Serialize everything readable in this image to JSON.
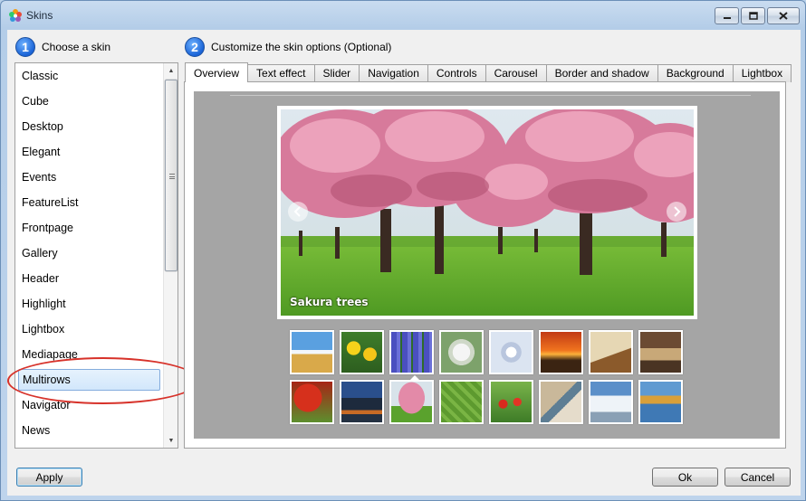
{
  "window": {
    "title": "Skins"
  },
  "steps": {
    "step1": {
      "number": "1",
      "label": "Choose a skin"
    },
    "step2": {
      "number": "2",
      "label": "Customize the skin options (Optional)"
    }
  },
  "skins": {
    "items": [
      "Classic",
      "Cube",
      "Desktop",
      "Elegant",
      "Events",
      "FeatureList",
      "Frontpage",
      "Gallery",
      "Header",
      "Highlight",
      "Lightbox",
      "Mediapage",
      "Multirows",
      "Navigator",
      "News"
    ],
    "selected": "Multirows"
  },
  "tabs": [
    "Overview",
    "Text effect",
    "Slider",
    "Navigation",
    "Controls",
    "Carousel",
    "Border and shadow",
    "Background",
    "Lightbox"
  ],
  "active_tab": "Overview",
  "preview": {
    "caption": "Sakura trees",
    "thumbnails_row1": [
      "wheat-field",
      "daffodils",
      "hyacinths",
      "dandelion",
      "video-thumbnail",
      "sunset",
      "open-book",
      "dream-title"
    ],
    "thumbnails_row2": [
      "red-ivy-house",
      "city-night",
      "sakura-trees",
      "green-leaf",
      "red-tulips",
      "beach-shells",
      "snow-mountains",
      "lake-trees"
    ],
    "selected_thumbnail": "sakura-trees"
  },
  "buttons": {
    "apply": "Apply",
    "ok": "Ok",
    "cancel": "Cancel"
  },
  "colors": {
    "accent": "#1a63d6",
    "highlight_ring": "#d7322a",
    "preview_bg": "#a5a5a5"
  }
}
